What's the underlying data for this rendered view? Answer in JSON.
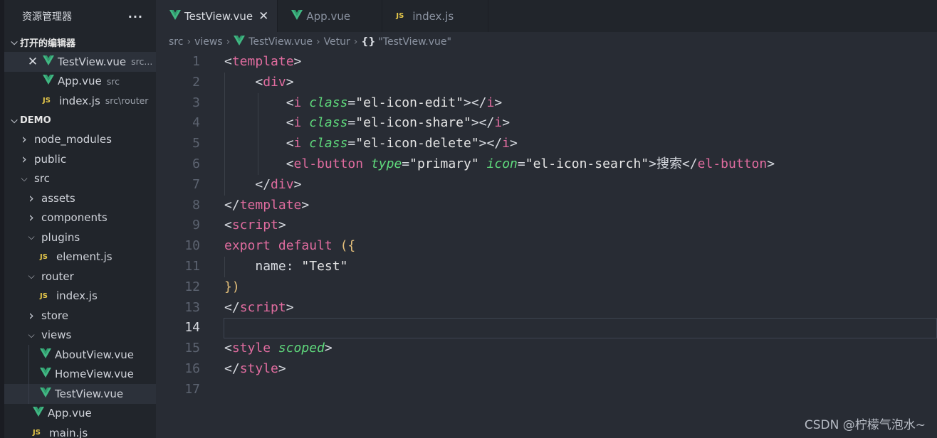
{
  "sidebar": {
    "title": "资源管理器",
    "more": "···",
    "open_editors": {
      "title": "打开的编辑器",
      "items": [
        {
          "name": "TestView.vue",
          "desc": "src...",
          "icon": "vue-icon",
          "selected": true,
          "close": "✕"
        },
        {
          "name": "App.vue",
          "desc": "src",
          "icon": "vue-icon"
        },
        {
          "name": "index.js",
          "desc": "src\\router",
          "icon": "js-icon"
        }
      ]
    },
    "project": {
      "title": "DEMO",
      "items": [
        {
          "name": "node_modules",
          "type": "folder",
          "depth": 0,
          "open": false
        },
        {
          "name": "public",
          "type": "folder",
          "depth": 0,
          "open": false
        },
        {
          "name": "src",
          "type": "folder",
          "depth": 0,
          "open": true
        },
        {
          "name": "assets",
          "type": "folder",
          "depth": 1,
          "open": false
        },
        {
          "name": "components",
          "type": "folder",
          "depth": 1,
          "open": false
        },
        {
          "name": "plugins",
          "type": "folder",
          "depth": 1,
          "open": true
        },
        {
          "name": "element.js",
          "type": "js",
          "depth": 2
        },
        {
          "name": "router",
          "type": "folder",
          "depth": 1,
          "open": true
        },
        {
          "name": "index.js",
          "type": "js",
          "depth": 2
        },
        {
          "name": "store",
          "type": "folder",
          "depth": 1,
          "open": false
        },
        {
          "name": "views",
          "type": "folder",
          "depth": 1,
          "open": true
        },
        {
          "name": "AboutView.vue",
          "type": "vue",
          "depth": 2
        },
        {
          "name": "HomeView.vue",
          "type": "vue",
          "depth": 2
        },
        {
          "name": "TestView.vue",
          "type": "vue",
          "depth": 2,
          "selected": true
        },
        {
          "name": "App.vue",
          "type": "vue",
          "depth": 1
        },
        {
          "name": "main.js",
          "type": "js",
          "depth": 1
        }
      ]
    },
    "js_label": "JS"
  },
  "tabs": [
    {
      "label": "TestView.vue",
      "icon": "vue-icon",
      "active": true,
      "close": "✕"
    },
    {
      "label": "App.vue",
      "icon": "vue-icon"
    },
    {
      "label": "index.js",
      "icon": "js-icon"
    }
  ],
  "breadcrumb": {
    "parts": [
      "src",
      "views",
      "TestView.vue",
      "Vetur"
    ],
    "braces": "{}",
    "symbol": "\"TestView.vue\""
  },
  "editor": {
    "current_line": 14,
    "lines": [
      [
        [
          "tk-br",
          "<"
        ],
        [
          "tk-tag",
          "template"
        ],
        [
          "tk-br",
          ">"
        ]
      ],
      [
        [
          "tk-txt",
          "    "
        ],
        [
          "tk-br",
          "<"
        ],
        [
          "tk-tag",
          "div"
        ],
        [
          "tk-br",
          ">"
        ]
      ],
      [
        [
          "tk-txt",
          "        "
        ],
        [
          "tk-br",
          "<"
        ],
        [
          "tk-tag",
          "i"
        ],
        [
          "tk-txt",
          " "
        ],
        [
          "tk-attr",
          "class"
        ],
        [
          "tk-br",
          "="
        ],
        [
          "tk-str",
          "\"el-icon-edit\""
        ],
        [
          "tk-br",
          "></"
        ],
        [
          "tk-tag",
          "i"
        ],
        [
          "tk-br",
          ">"
        ]
      ],
      [
        [
          "tk-txt",
          "        "
        ],
        [
          "tk-br",
          "<"
        ],
        [
          "tk-tag",
          "i"
        ],
        [
          "tk-txt",
          " "
        ],
        [
          "tk-attr",
          "class"
        ],
        [
          "tk-br",
          "="
        ],
        [
          "tk-str",
          "\"el-icon-share\""
        ],
        [
          "tk-br",
          "></"
        ],
        [
          "tk-tag",
          "i"
        ],
        [
          "tk-br",
          ">"
        ]
      ],
      [
        [
          "tk-txt",
          "        "
        ],
        [
          "tk-br",
          "<"
        ],
        [
          "tk-tag",
          "i"
        ],
        [
          "tk-txt",
          " "
        ],
        [
          "tk-attr",
          "class"
        ],
        [
          "tk-br",
          "="
        ],
        [
          "tk-str",
          "\"el-icon-delete\""
        ],
        [
          "tk-br",
          "></"
        ],
        [
          "tk-tag",
          "i"
        ],
        [
          "tk-br",
          ">"
        ]
      ],
      [
        [
          "tk-txt",
          "        "
        ],
        [
          "tk-br",
          "<"
        ],
        [
          "tk-tag",
          "el-button"
        ],
        [
          "tk-txt",
          " "
        ],
        [
          "tk-attr",
          "type"
        ],
        [
          "tk-br",
          "="
        ],
        [
          "tk-str",
          "\"primary\""
        ],
        [
          "tk-txt",
          " "
        ],
        [
          "tk-attr",
          "icon"
        ],
        [
          "tk-br",
          "="
        ],
        [
          "tk-str",
          "\"el-icon-search\""
        ],
        [
          "tk-br",
          ">"
        ],
        [
          "tk-txt",
          "搜索"
        ],
        [
          "tk-br",
          "</"
        ],
        [
          "tk-tag",
          "el-button"
        ],
        [
          "tk-br",
          ">"
        ]
      ],
      [
        [
          "tk-txt",
          "    "
        ],
        [
          "tk-br",
          "</"
        ],
        [
          "tk-tag",
          "div"
        ],
        [
          "tk-br",
          ">"
        ]
      ],
      [
        [
          "tk-br",
          "</"
        ],
        [
          "tk-tag",
          "template"
        ],
        [
          "tk-br",
          ">"
        ]
      ],
      [
        [
          "tk-br",
          "<"
        ],
        [
          "tk-tag",
          "script"
        ],
        [
          "tk-br",
          ">"
        ]
      ],
      [
        [
          "tk-kw",
          "export"
        ],
        [
          "tk-txt",
          " "
        ],
        [
          "tk-kw",
          "default"
        ],
        [
          "tk-txt",
          " "
        ],
        [
          "tk-paren",
          "({"
        ]
      ],
      [
        [
          "tk-txt",
          "    "
        ],
        [
          "tk-prop",
          "name"
        ],
        [
          "tk-br",
          ": "
        ],
        [
          "tk-str",
          "\"Test\""
        ]
      ],
      [
        [
          "tk-paren",
          "})"
        ]
      ],
      [
        [
          "tk-br",
          "</"
        ],
        [
          "tk-tag",
          "script"
        ],
        [
          "tk-br",
          ">"
        ]
      ],
      [],
      [
        [
          "tk-br",
          "<"
        ],
        [
          "tk-tag",
          "style"
        ],
        [
          "tk-txt",
          " "
        ],
        [
          "tk-attr",
          "scoped"
        ],
        [
          "tk-br",
          ">"
        ]
      ],
      [
        [
          "tk-br",
          "</"
        ],
        [
          "tk-tag",
          "style"
        ],
        [
          "tk-br",
          ">"
        ]
      ],
      []
    ]
  },
  "watermark": "CSDN @柠檬气泡水~",
  "colors": {
    "vue_green": "#41b883",
    "js_yellow": "#e6c84a",
    "accent_tag": "#e06c9f"
  }
}
